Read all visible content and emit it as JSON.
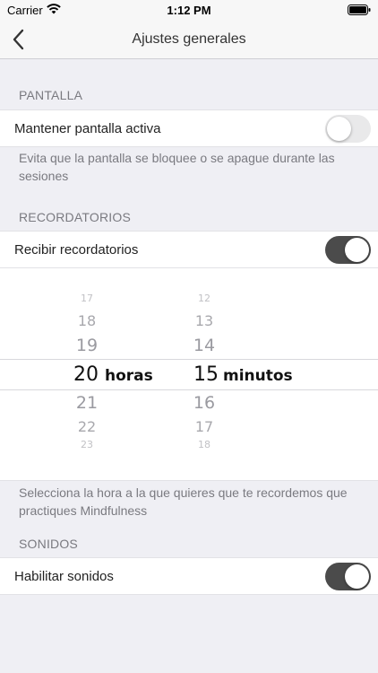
{
  "status_bar": {
    "carrier": "Carrier",
    "time": "1:12 PM"
  },
  "nav": {
    "title": "Ajustes generales",
    "back_icon": "chevron-left-icon"
  },
  "sections": {
    "pantalla": {
      "header": "PANTALLA",
      "row_label": "Mantener pantalla activa",
      "toggle_on": false,
      "footer": "Evita que la pantalla se bloquee o se apague durante las sesiones"
    },
    "recordatorios": {
      "header": "RECORDATORIOS",
      "row_label": "Recibir recordatorios",
      "toggle_on": true,
      "footer": "Selecciona la hora a la que quieres que te recordemos que practiques Mindfulness"
    },
    "sonidos": {
      "header": "SONIDOS",
      "row_label": "Habilitar sonidos",
      "toggle_on": true
    }
  },
  "picker": {
    "hours_above": [
      "17",
      "18",
      "19"
    ],
    "hour_selected": "20",
    "hour_unit": "horas",
    "hours_below": [
      "21",
      "22",
      "23"
    ],
    "minutes_above": [
      "12",
      "13",
      "14"
    ],
    "minute_selected": "15",
    "minute_unit": "minutos",
    "minutes_below": [
      "16",
      "17",
      "18"
    ]
  },
  "colors": {
    "toggle_on": "#4b4b4b",
    "toggle_off": "#e9e9ea",
    "background": "#efeff4"
  }
}
